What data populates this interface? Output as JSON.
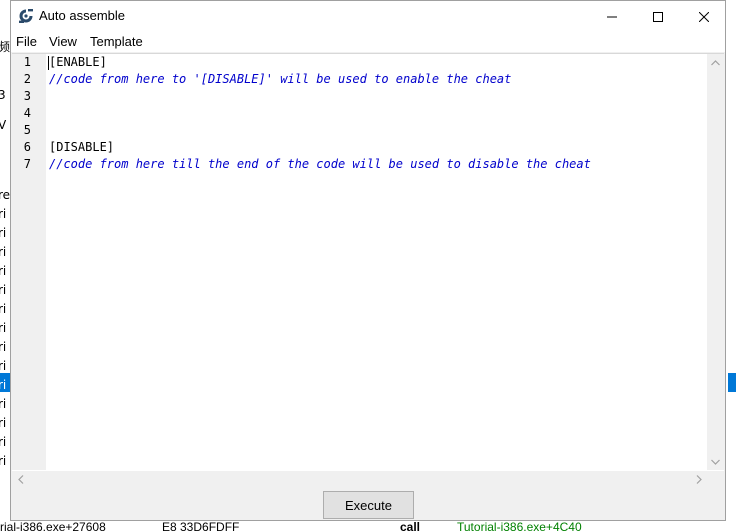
{
  "window": {
    "title": "Auto assemble",
    "minimize_icon": "minimize-icon",
    "maximize_icon": "maximize-icon",
    "close_icon": "close-icon"
  },
  "menu": {
    "items": [
      "File",
      "View",
      "Template"
    ]
  },
  "editor": {
    "line_numbers": [
      "1",
      "2",
      "3",
      "4",
      "5",
      "6",
      "7"
    ],
    "lines": [
      {
        "text": "[ENABLE]",
        "kind": "keyword"
      },
      {
        "text": "//code from here to '[DISABLE]' will be used to enable the cheat",
        "kind": "comment"
      },
      {
        "text": "",
        "kind": "keyword"
      },
      {
        "text": "",
        "kind": "keyword"
      },
      {
        "text": "",
        "kind": "keyword"
      },
      {
        "text": "[DISABLE]",
        "kind": "keyword"
      },
      {
        "text": "//code from here till the end of the code will be used to disable the cheat",
        "kind": "comment"
      }
    ],
    "comment_color": "#0000cc"
  },
  "buttons": {
    "execute": "Execute"
  },
  "background": {
    "left_fragments": [
      "频",
      "3",
      "V",
      "re",
      "ri",
      "ri",
      "ri",
      "ri",
      "ri",
      "ri",
      "ri",
      "ri",
      "ri",
      "ri",
      "ri",
      "ri",
      "ri",
      "ri"
    ],
    "bottom_row": {
      "address": "rial-i386.exe+27608",
      "bytes": "E8 33D6FDFF",
      "opcode": "call",
      "operand": "Tutorial-i386.exe+4C40"
    },
    "selection_color": "#0078d7"
  }
}
